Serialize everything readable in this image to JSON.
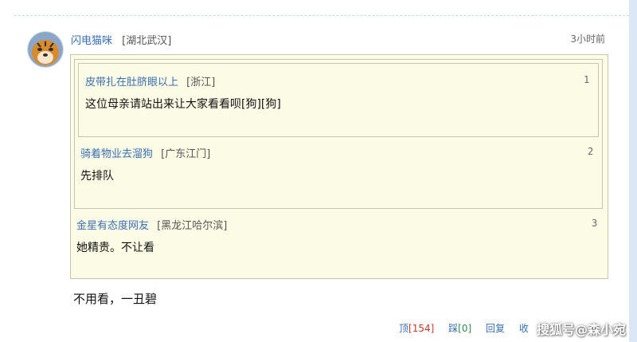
{
  "post": {
    "user": "闪电猫咪",
    "location": "[湖北武汉]",
    "time": "3小时前",
    "text": "不用看，一丑碧"
  },
  "quotes": [
    {
      "user": "皮带扎在肚脐眼以上",
      "location": "[浙江]",
      "index": "1",
      "text": "这位母亲请站出来让大家看看呗[狗][狗]"
    },
    {
      "user": "骑着物业去溜狗",
      "location": "[广东江门]",
      "index": "2",
      "text": "先排队"
    },
    {
      "user": "金星有态度网友",
      "location": "[黑龙江哈尔滨]",
      "index": "3",
      "text": "她精贵。不让看"
    }
  ],
  "actions": {
    "up_label": "顶",
    "up_count": "[154]",
    "down_label": "踩",
    "down_count": "[0]",
    "reply_label": "回复",
    "collect_label": "收"
  },
  "watermark": "搜狐号@森小宛",
  "colors": {
    "link": "#3a6fb0",
    "quote_bg": "#fcfbe6",
    "quote_border": "#c8c7ad",
    "count_red": "#c0392b",
    "count_green": "#2e8b57"
  }
}
